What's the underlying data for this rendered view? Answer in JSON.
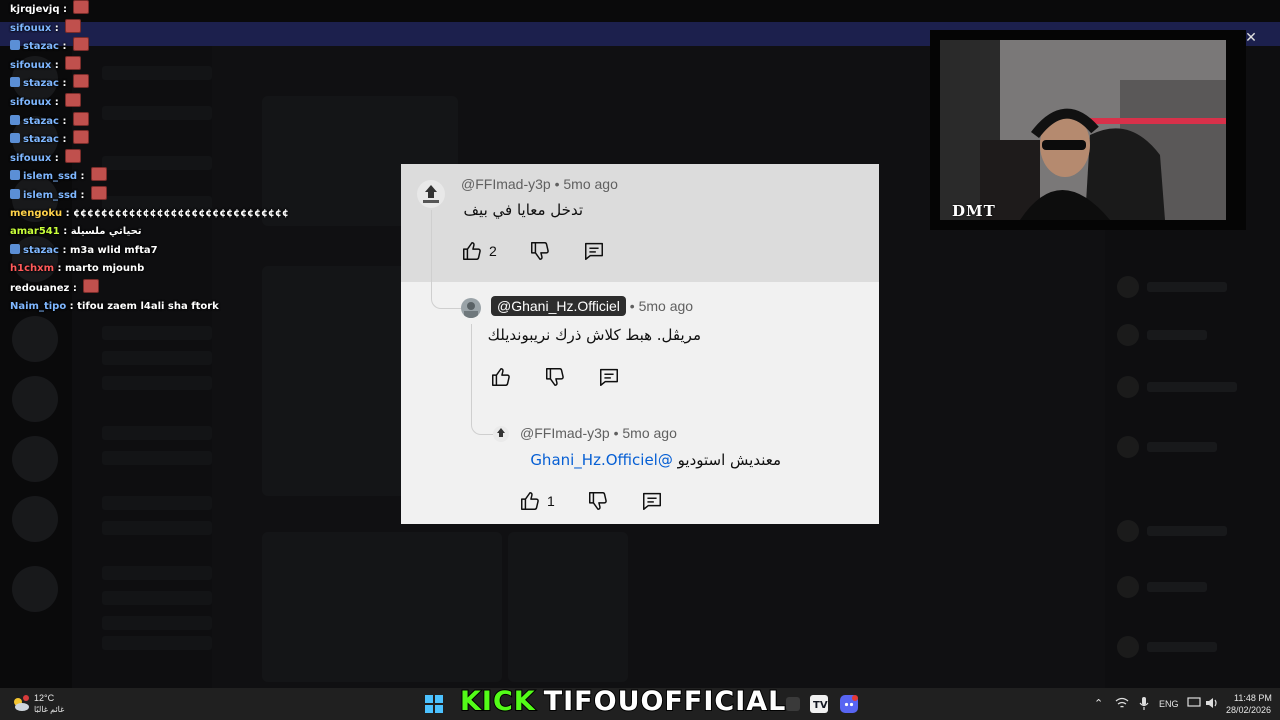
{
  "chat": {
    "lines": [
      {
        "user": "kjrqjevjq",
        "color": "#ffffff",
        "text": "",
        "badge": false,
        "emote": true
      },
      {
        "user": "sifouux",
        "color": "#7fb7ff",
        "text": "",
        "badge": false,
        "emote": true
      },
      {
        "user": "stazac",
        "color": "#7fb7ff",
        "text": "",
        "badge": true,
        "emote": true
      },
      {
        "user": "sifouux",
        "color": "#7fb7ff",
        "text": "",
        "badge": false,
        "emote": true
      },
      {
        "user": "stazac",
        "color": "#7fb7ff",
        "text": "",
        "badge": true,
        "emote": true
      },
      {
        "user": "sifouux",
        "color": "#7fb7ff",
        "text": "",
        "badge": false,
        "emote": true
      },
      {
        "user": "stazac",
        "color": "#7fb7ff",
        "text": "",
        "badge": true,
        "emote": true
      },
      {
        "user": "stazac",
        "color": "#7fb7ff",
        "text": "",
        "badge": true,
        "emote": true
      },
      {
        "user": "sifouux",
        "color": "#7fb7ff",
        "text": "",
        "badge": false,
        "emote": true
      },
      {
        "user": "islem_ssd",
        "color": "#7fb7ff",
        "text": "",
        "badge": true,
        "emote": true
      },
      {
        "user": "islem_ssd",
        "color": "#7fb7ff",
        "text": "",
        "badge": true,
        "emote": true
      },
      {
        "user": "mengoku",
        "color": "#ffd24a",
        "text": "¢¢¢¢¢¢¢¢¢¢¢¢¢¢¢¢¢¢¢¢¢¢¢¢¢¢¢¢¢¢¢",
        "badge": false,
        "emote": false
      },
      {
        "user": "amar541",
        "color": "#c9ff3a",
        "text": "تحياتي ملسيلة",
        "badge": false,
        "emote": false
      },
      {
        "user": "stazac",
        "color": "#7fb7ff",
        "text": "m3a wlid mfta7",
        "badge": true,
        "emote": false
      },
      {
        "user": "h1chxm",
        "color": "#ff5a5a",
        "text": "marto mjounb",
        "badge": false,
        "emote": false
      },
      {
        "user": "redouanez",
        "color": "#ffffff",
        "text": "",
        "badge": false,
        "emote": true
      },
      {
        "user": "Naim_tipo",
        "color": "#7fb7ff",
        "text": "tifou zaem l4ali sha ftork",
        "badge": false,
        "emote": false
      }
    ]
  },
  "comments": {
    "c1": {
      "handle": "@FFImad-y3p",
      "age": "• 5mo ago",
      "text": "تدخل معايا في بيف",
      "likes": "2"
    },
    "c2": {
      "handle": "@Ghani_Hz.Officiel",
      "age": "• 5mo ago",
      "text": "مريڨل. هبط كلاش ذرك نريبونديلك"
    },
    "c3": {
      "handle": "@FFImad-y3p",
      "age": "• 5mo ago",
      "mention": "@Ghani_Hz.Officiel",
      "text": "معنديش استوديو",
      "likes": "1"
    }
  },
  "webcam": {
    "logo": "DMT",
    "close_icon": "close-icon"
  },
  "taskbar": {
    "weather_temp": "12°C",
    "weather_desc": "غائم غالبًا",
    "kick_label": "KICK",
    "channel": "TIFOUOFFICIAL",
    "language": "ENG",
    "time": "11:48 PM",
    "date": "28/02/2026"
  },
  "colors": {
    "kick_green": "#53fc18",
    "youtube_link": "#065fd4",
    "discord_bg": "#313338"
  }
}
